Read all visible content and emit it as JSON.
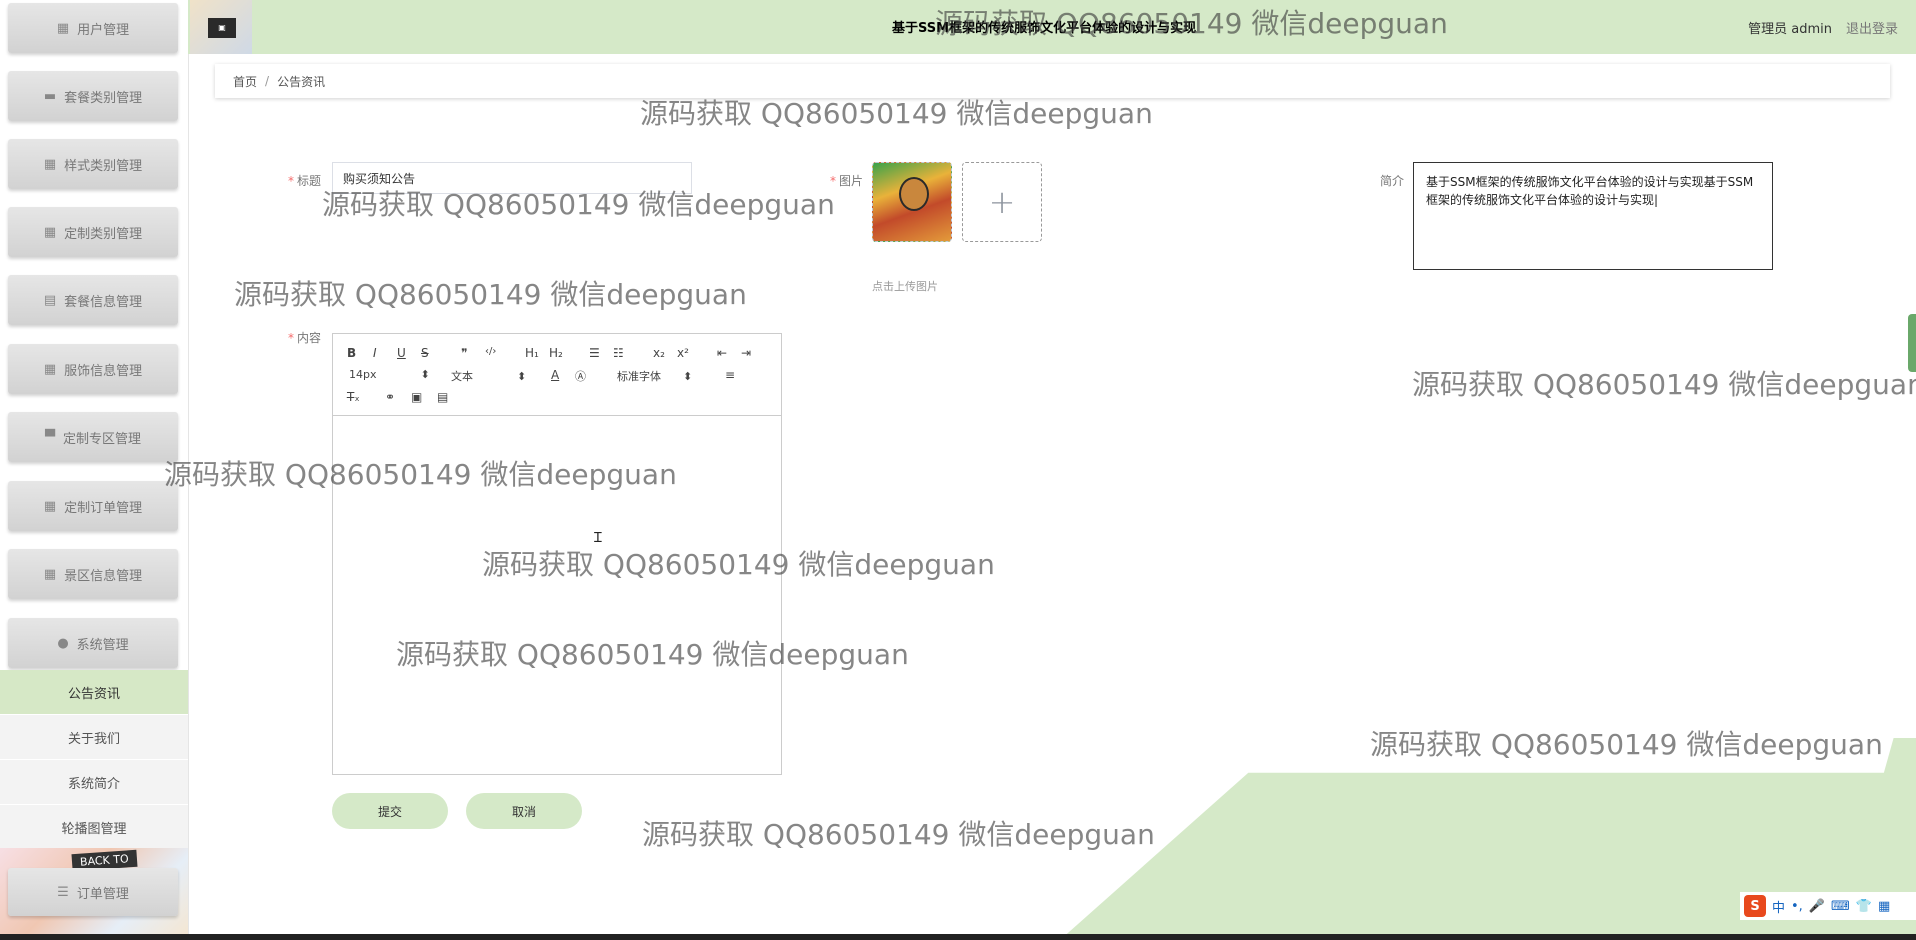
{
  "header": {
    "site_title": "基于SSM框架的传统服饰文化平台体验的设计与实现",
    "admin_info": "管理员 admin",
    "logout": "退出登录"
  },
  "sidebar": {
    "items": [
      {
        "label": "用户管理",
        "icon": "grid-icon"
      },
      {
        "label": "套餐类别管理",
        "icon": "briefcase-icon"
      },
      {
        "label": "样式类别管理",
        "icon": "grid-icon"
      },
      {
        "label": "定制类别管理",
        "icon": "grid-icon"
      },
      {
        "label": "套餐信息管理",
        "icon": "clipboard-icon"
      },
      {
        "label": "服饰信息管理",
        "icon": "grid-icon"
      },
      {
        "label": "定制专区管理",
        "icon": "monitor-icon"
      },
      {
        "label": "定制订单管理",
        "icon": "grid-icon"
      },
      {
        "label": "景区信息管理",
        "icon": "grid-icon"
      },
      {
        "label": "系统管理",
        "icon": "bulb-icon"
      }
    ],
    "sub_items": [
      {
        "label": "公告资讯",
        "active": true
      },
      {
        "label": "关于我们",
        "active": false
      },
      {
        "label": "系统简介",
        "active": false
      },
      {
        "label": "轮播图管理",
        "active": false
      }
    ],
    "bottom_item": {
      "label": "订单管理",
      "icon": "list-icon"
    },
    "art_text": "BACK TO"
  },
  "breadcrumb": {
    "home": "首页",
    "separator": "/",
    "current": "公告资讯"
  },
  "form": {
    "title_label": "标题",
    "title_value": "购买须知公告",
    "image_label": "图片",
    "upload_plus": "+",
    "upload_hint": "点击上传图片",
    "intro_label": "简介",
    "intro_value": "基于SSM框架的传统服饰文化平台体验的设计与实现基于SSM框架的传统服饰文化平台体验的设计与实现|",
    "content_label": "内容",
    "required_mark": "*"
  },
  "editor": {
    "font_size": "14px",
    "header_select": "文本",
    "font_family": "标准字体",
    "toolbar": {
      "bold": "B",
      "italic": "I",
      "underline": "U",
      "strike": "S",
      "quote": "❞",
      "code": "‹/›",
      "h1": "H₁",
      "h2": "H₂",
      "ordered_list": "☰",
      "bullet_list": "☷",
      "subscript": "x₂",
      "superscript": "x²",
      "outdent": "⇤",
      "indent": "⇥",
      "font_color": "A",
      "background_color": "Ⓐ",
      "align": "≡",
      "clean": "T̶ₓ",
      "link": "⚭",
      "image": "▣",
      "video": "▤"
    }
  },
  "buttons": {
    "submit": "提交",
    "cancel": "取消"
  },
  "watermark": "源码获取 QQ86050149 微信deepguan",
  "ime": {
    "logo": "S",
    "mode": "中",
    "punct": "•,",
    "mic": "🎤",
    "keyboard": "⌨",
    "skin": "👕",
    "apps": "▦"
  },
  "colors": {
    "accent": "#d5e9c8",
    "active_sub": "#d6e8c6",
    "required": "#f56c6c"
  }
}
